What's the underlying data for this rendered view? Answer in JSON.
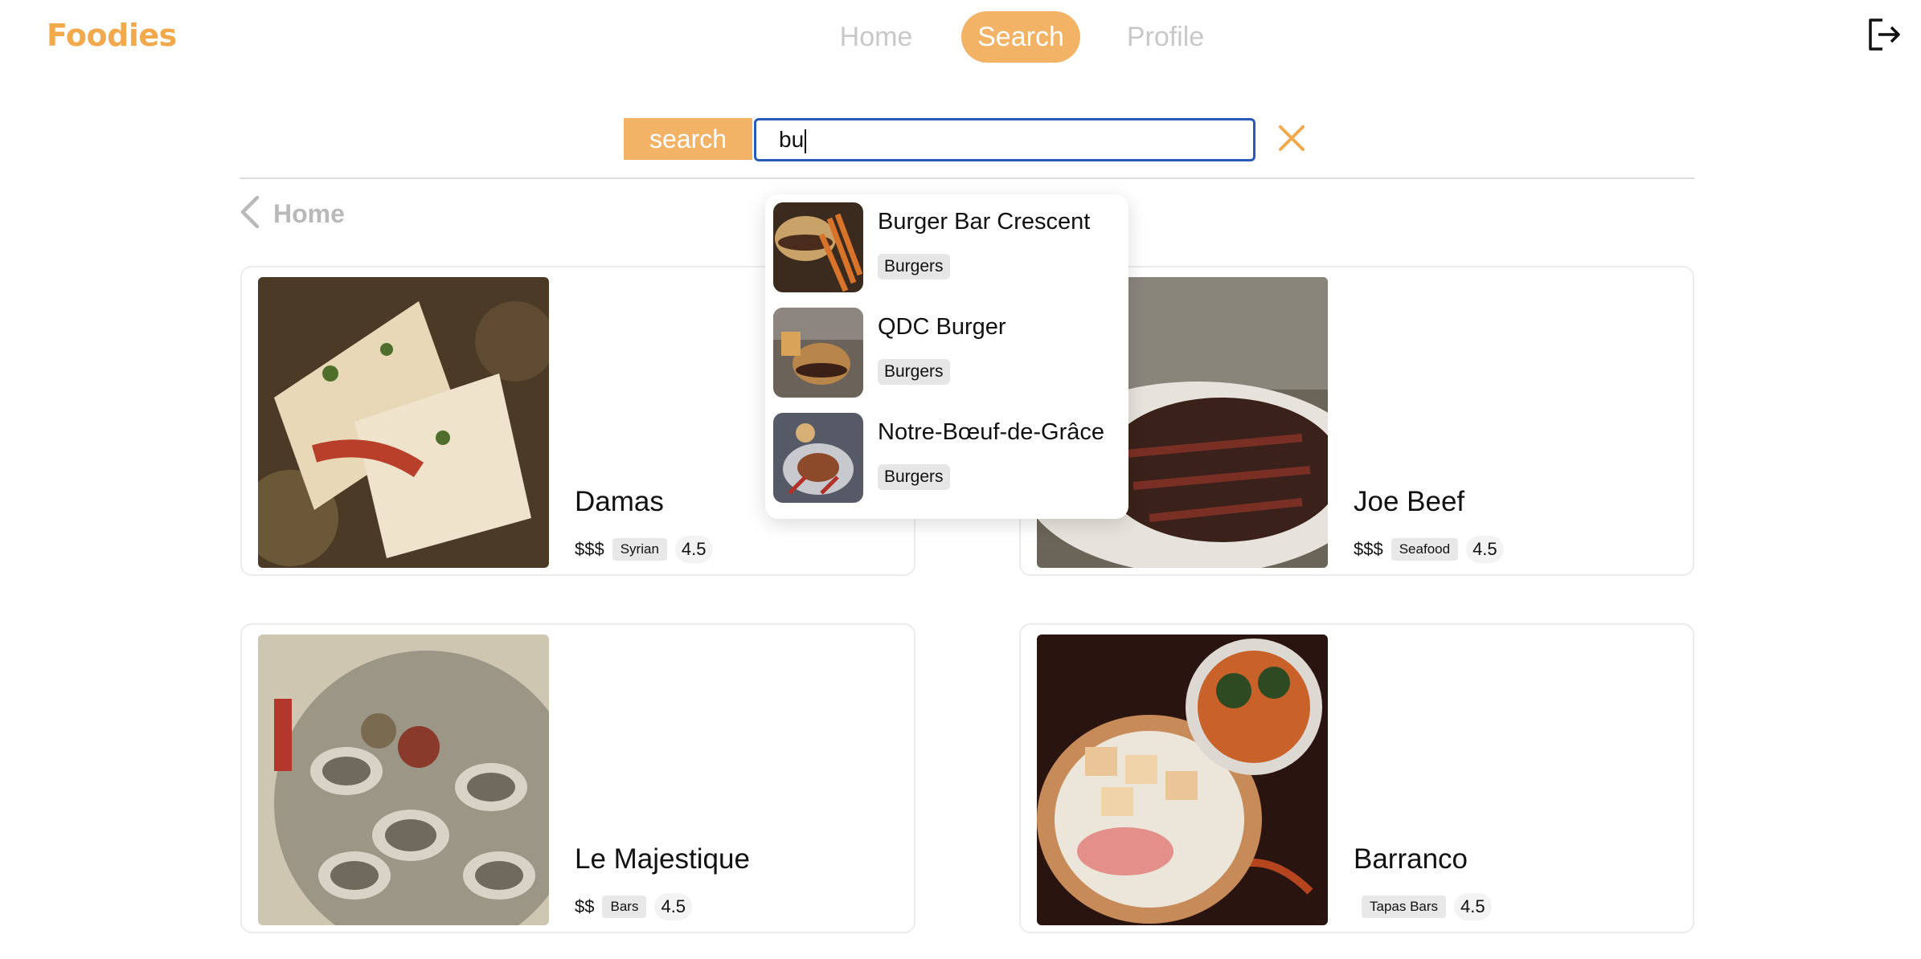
{
  "brand": {
    "logo": "Foodies",
    "accent": "#f2b366"
  },
  "nav": {
    "home": "Home",
    "search": "Search",
    "profile": "Profile",
    "logout_icon": "logout-icon"
  },
  "search": {
    "button_label": "search",
    "value": "bu",
    "clear_icon": "close-icon"
  },
  "back": {
    "label": "Home",
    "icon": "chevron-left-icon"
  },
  "suggestions": [
    {
      "name": "Burger Bar Crescent",
      "tag": "Burgers"
    },
    {
      "name": "QDC Burger",
      "tag": "Burgers"
    },
    {
      "name": "Notre-Bœuf-de-Grâce",
      "tag": "Burgers"
    }
  ],
  "restaurants": [
    {
      "name": "Damas",
      "price": "$$$",
      "tag": "Syrian",
      "rating": "4.5"
    },
    {
      "name": "Joe Beef",
      "price": "$$$",
      "tag": "Seafood",
      "rating": "4.5"
    },
    {
      "name": "Le Majestique",
      "price": "$$",
      "tag": "Bars",
      "rating": "4.5"
    },
    {
      "name": "Barranco",
      "price": "",
      "tag": "Tapas Bars",
      "rating": "4.5"
    }
  ]
}
